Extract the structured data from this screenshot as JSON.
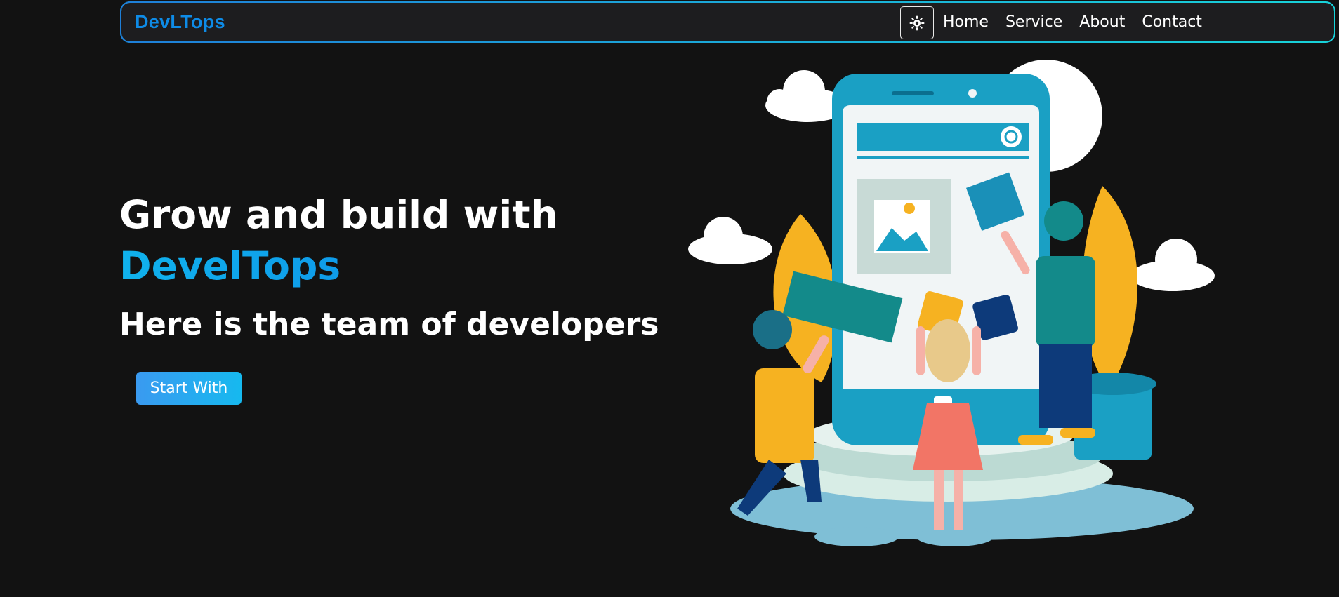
{
  "nav": {
    "brand": "DevLTops",
    "theme_icon": "sun-icon",
    "links": [
      {
        "label": "Home"
      },
      {
        "label": "Service"
      },
      {
        "label": "About"
      },
      {
        "label": "Contact"
      }
    ]
  },
  "hero": {
    "title_line1": "Grow and build with",
    "title_brand": "DevelTops",
    "subtitle": "Here is the team of developers",
    "cta_label": "Start With"
  },
  "illustration": {
    "icon": "team-building-app-illustration"
  },
  "colors": {
    "background": "#121212",
    "navbar_bg": "#1d1d1f",
    "accent_blue": "#0e8be6",
    "accent_cyan": "#18d3d8",
    "button": "#2ba6f0"
  }
}
